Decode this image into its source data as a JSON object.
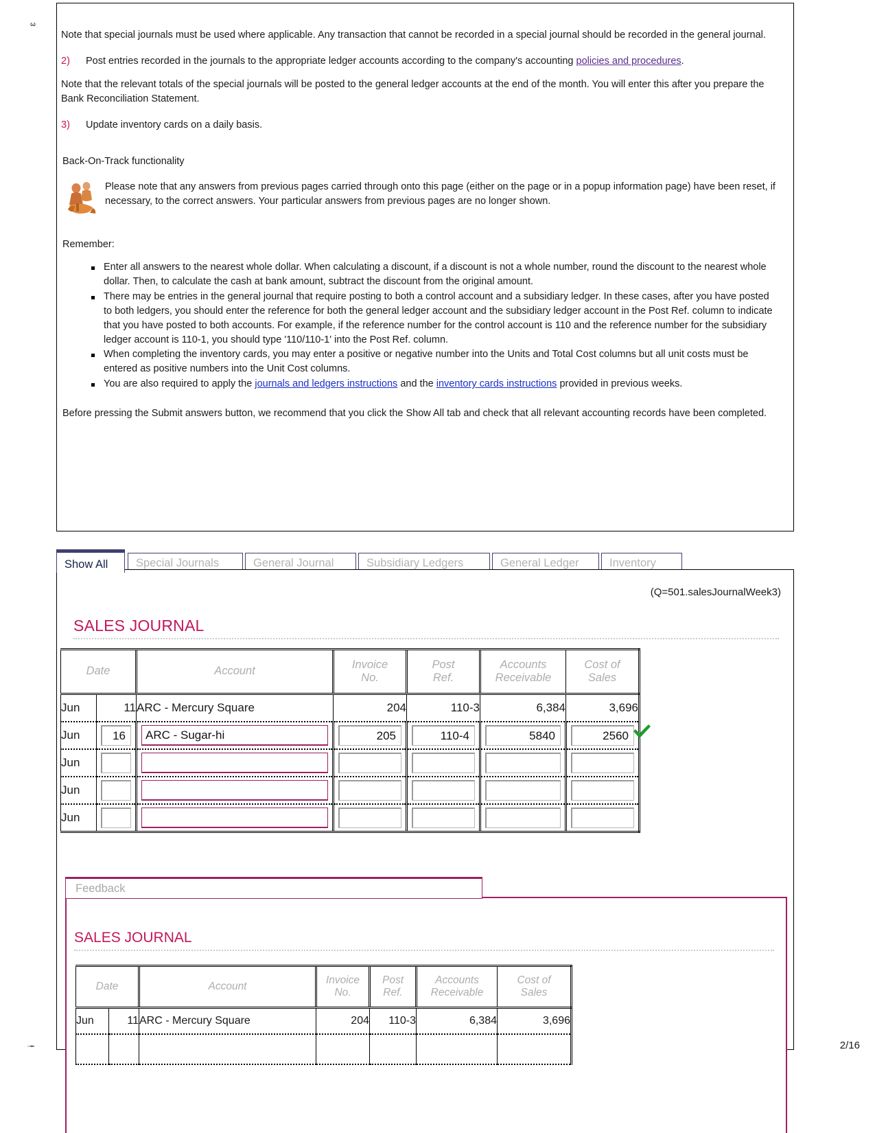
{
  "margins": {
    "top_left_mark": "ɛ",
    "bottom_left_mark": "ɨ",
    "page_number": "2/16"
  },
  "instructions": {
    "note_1": "Note that special journals must be used where applicable. Any transaction that cannot be recorded in a special journal should be recorded in the general journal.",
    "item_2_num": "2)",
    "item_2_text_before": "Post entries recorded in the journals to the appropriate ledger accounts according to the company's accounting ",
    "item_2_link": " policies and procedures",
    "item_2_text_after": ".",
    "note_2": "Note that the relevant totals of the special journals will be posted to the general ledger accounts at the end of the month. You will enter this after you prepare the Bank Reconciliation Statement.",
    "item_3_num": "3)",
    "item_3_text": "Update inventory cards on a daily basis.",
    "back_on_track_heading": "Back-On-Track functionality",
    "back_on_track_note": "Please note that any answers from previous pages carried through onto this page (either on the page or in a popup information page) have been reset, if necessary, to the correct answers. Your particular answers from previous pages are no longer shown.",
    "remember_label": "Remember:",
    "bullets": [
      "Enter all answers to the nearest whole dollar. When calculating a discount, if a discount is not a whole number, round the discount to the nearest whole dollar. Then, to calculate the cash at bank amount, subtract the discount from the original amount.",
      "There may be entries in the general journal that require posting to both a control account and a subsidiary ledger. In these cases, after you have posted to both ledgers, you should enter the reference for both the general ledger account and the subsidiary ledger account in the Post Ref. column to indicate that you have posted to both accounts. For example, if the reference number for the control account is 110 and the reference number for the subsidiary ledger account is 110-1, you should type '110/110-1' into the Post Ref. column.",
      "When completing the inventory cards, you may enter a positive or negative number into the Units and Total Cost columns but all unit costs must be entered as positive numbers into the Unit Cost columns."
    ],
    "bullet_4_before": "You are also required to apply the ",
    "bullet_4_link1": "journals and ledgers instructions",
    "bullet_4_mid": " and the ",
    "bullet_4_link2": "inventory cards instructions",
    "bullet_4_after": " provided in previous weeks.",
    "closing": "Before pressing the Submit answers button, we recommend that you click the Show All tab and check that all relevant accounting records have been completed."
  },
  "tabs": [
    {
      "label": "Show All",
      "active": true
    },
    {
      "label": "Special Journals",
      "active": false
    },
    {
      "label": "General Journal",
      "active": false
    },
    {
      "label": "Subsidiary Ledgers",
      "active": false
    },
    {
      "label": "General Ledger",
      "active": false
    },
    {
      "label": "Inventory",
      "active": false
    }
  ],
  "main": {
    "question_tag": "(Q=501.salesJournalWeek3)",
    "journal_title": "SALES JOURNAL",
    "columns": [
      "Date",
      "Account",
      "Invoice No.",
      "Post Ref.",
      "Accounts Receivable",
      "Cost of Sales"
    ],
    "column_invoice_l1": "Invoice",
    "column_invoice_l2": "No.",
    "column_postref_l1": "Post",
    "column_postref_l2": "Ref.",
    "column_ar_l1": "Accounts",
    "column_ar_l2": "Receivable",
    "column_cos_l1": "Cost of",
    "column_cos_l2": "Sales",
    "rows": [
      {
        "type": "static",
        "month": "Jun",
        "day": "11",
        "account": "ARC - Mercury Square",
        "invoice": "204",
        "postref": "110-3",
        "ar": "6,384",
        "cos": "3,696"
      },
      {
        "type": "input",
        "month": "Jun",
        "day": "16",
        "account": "ARC - Sugar-hi",
        "invoice": "205",
        "postref": "110-4",
        "ar": "5840",
        "cos": "2560",
        "checked": true
      },
      {
        "type": "input",
        "month": "Jun",
        "day": "",
        "account": "",
        "invoice": "",
        "postref": "",
        "ar": "",
        "cos": "",
        "checked": false
      },
      {
        "type": "input",
        "month": "Jun",
        "day": "",
        "account": "",
        "invoice": "",
        "postref": "",
        "ar": "",
        "cos": "",
        "checked": false
      },
      {
        "type": "input",
        "month": "Jun",
        "day": "",
        "account": "",
        "invoice": "",
        "postref": "",
        "ar": "",
        "cos": "",
        "checked": false
      }
    ]
  },
  "feedback": {
    "tab_label": "Feedback",
    "journal_title": "SALES JOURNAL",
    "columns": [
      "Date",
      "Account",
      "Invoice No.",
      "Post Ref.",
      "Accounts Receivable",
      "Cost of Sales"
    ],
    "column_invoice_l1": "Invoice",
    "column_invoice_l2": "No.",
    "column_postref_l1": "Post",
    "column_postref_l2": "Ref.",
    "column_ar_l1": "Accounts",
    "column_ar_l2": "Receivable",
    "column_cos_l1": "Cost of",
    "column_cos_l2": "Sales",
    "rows": [
      {
        "month": "Jun",
        "day": "11",
        "account": "ARC - Mercury Square",
        "invoice": "204",
        "postref": "110-3",
        "ar": "6,384",
        "cos": "3,696"
      },
      {
        "month": "",
        "day": "",
        "account": "",
        "invoice": "",
        "postref": "",
        "ar": "",
        "cos": ""
      }
    ]
  },
  "colors": {
    "accent_magenta": "#c2185b",
    "tab_navy": "#3f3f72",
    "link_purple": "#5b2d8e",
    "link_blue": "#1a30c8",
    "feedback_border": "#9c2160",
    "check_green": "#1f9c2f"
  }
}
